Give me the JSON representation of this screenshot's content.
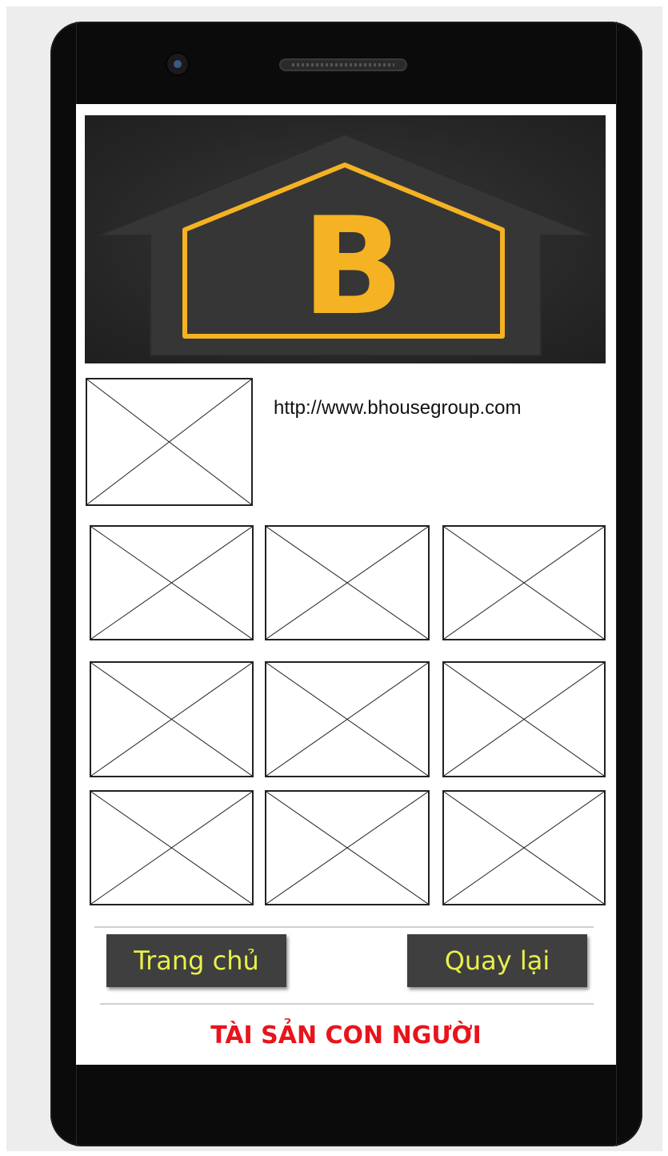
{
  "header": {
    "logo_letter": "B",
    "brand_color": "#f5b223"
  },
  "profile": {
    "avatar_icon": "image-placeholder-icon",
    "website_url": "http://www.bhousegroup.com"
  },
  "gallery": {
    "items": [
      {
        "icon": "image-placeholder-icon"
      },
      {
        "icon": "image-placeholder-icon"
      },
      {
        "icon": "image-placeholder-icon"
      },
      {
        "icon": "image-placeholder-icon"
      },
      {
        "icon": "image-placeholder-icon"
      },
      {
        "icon": "image-placeholder-icon"
      },
      {
        "icon": "image-placeholder-icon"
      },
      {
        "icon": "image-placeholder-icon"
      },
      {
        "icon": "image-placeholder-icon"
      }
    ]
  },
  "nav": {
    "home_label": "Trang chủ",
    "back_label": "Quay lại",
    "button_text_color": "#e9f04a",
    "button_bg_color": "#3f3f3f"
  },
  "footer": {
    "slogan": "TÀI SẢN CON NGƯỜI",
    "slogan_color": "#e8141c"
  }
}
